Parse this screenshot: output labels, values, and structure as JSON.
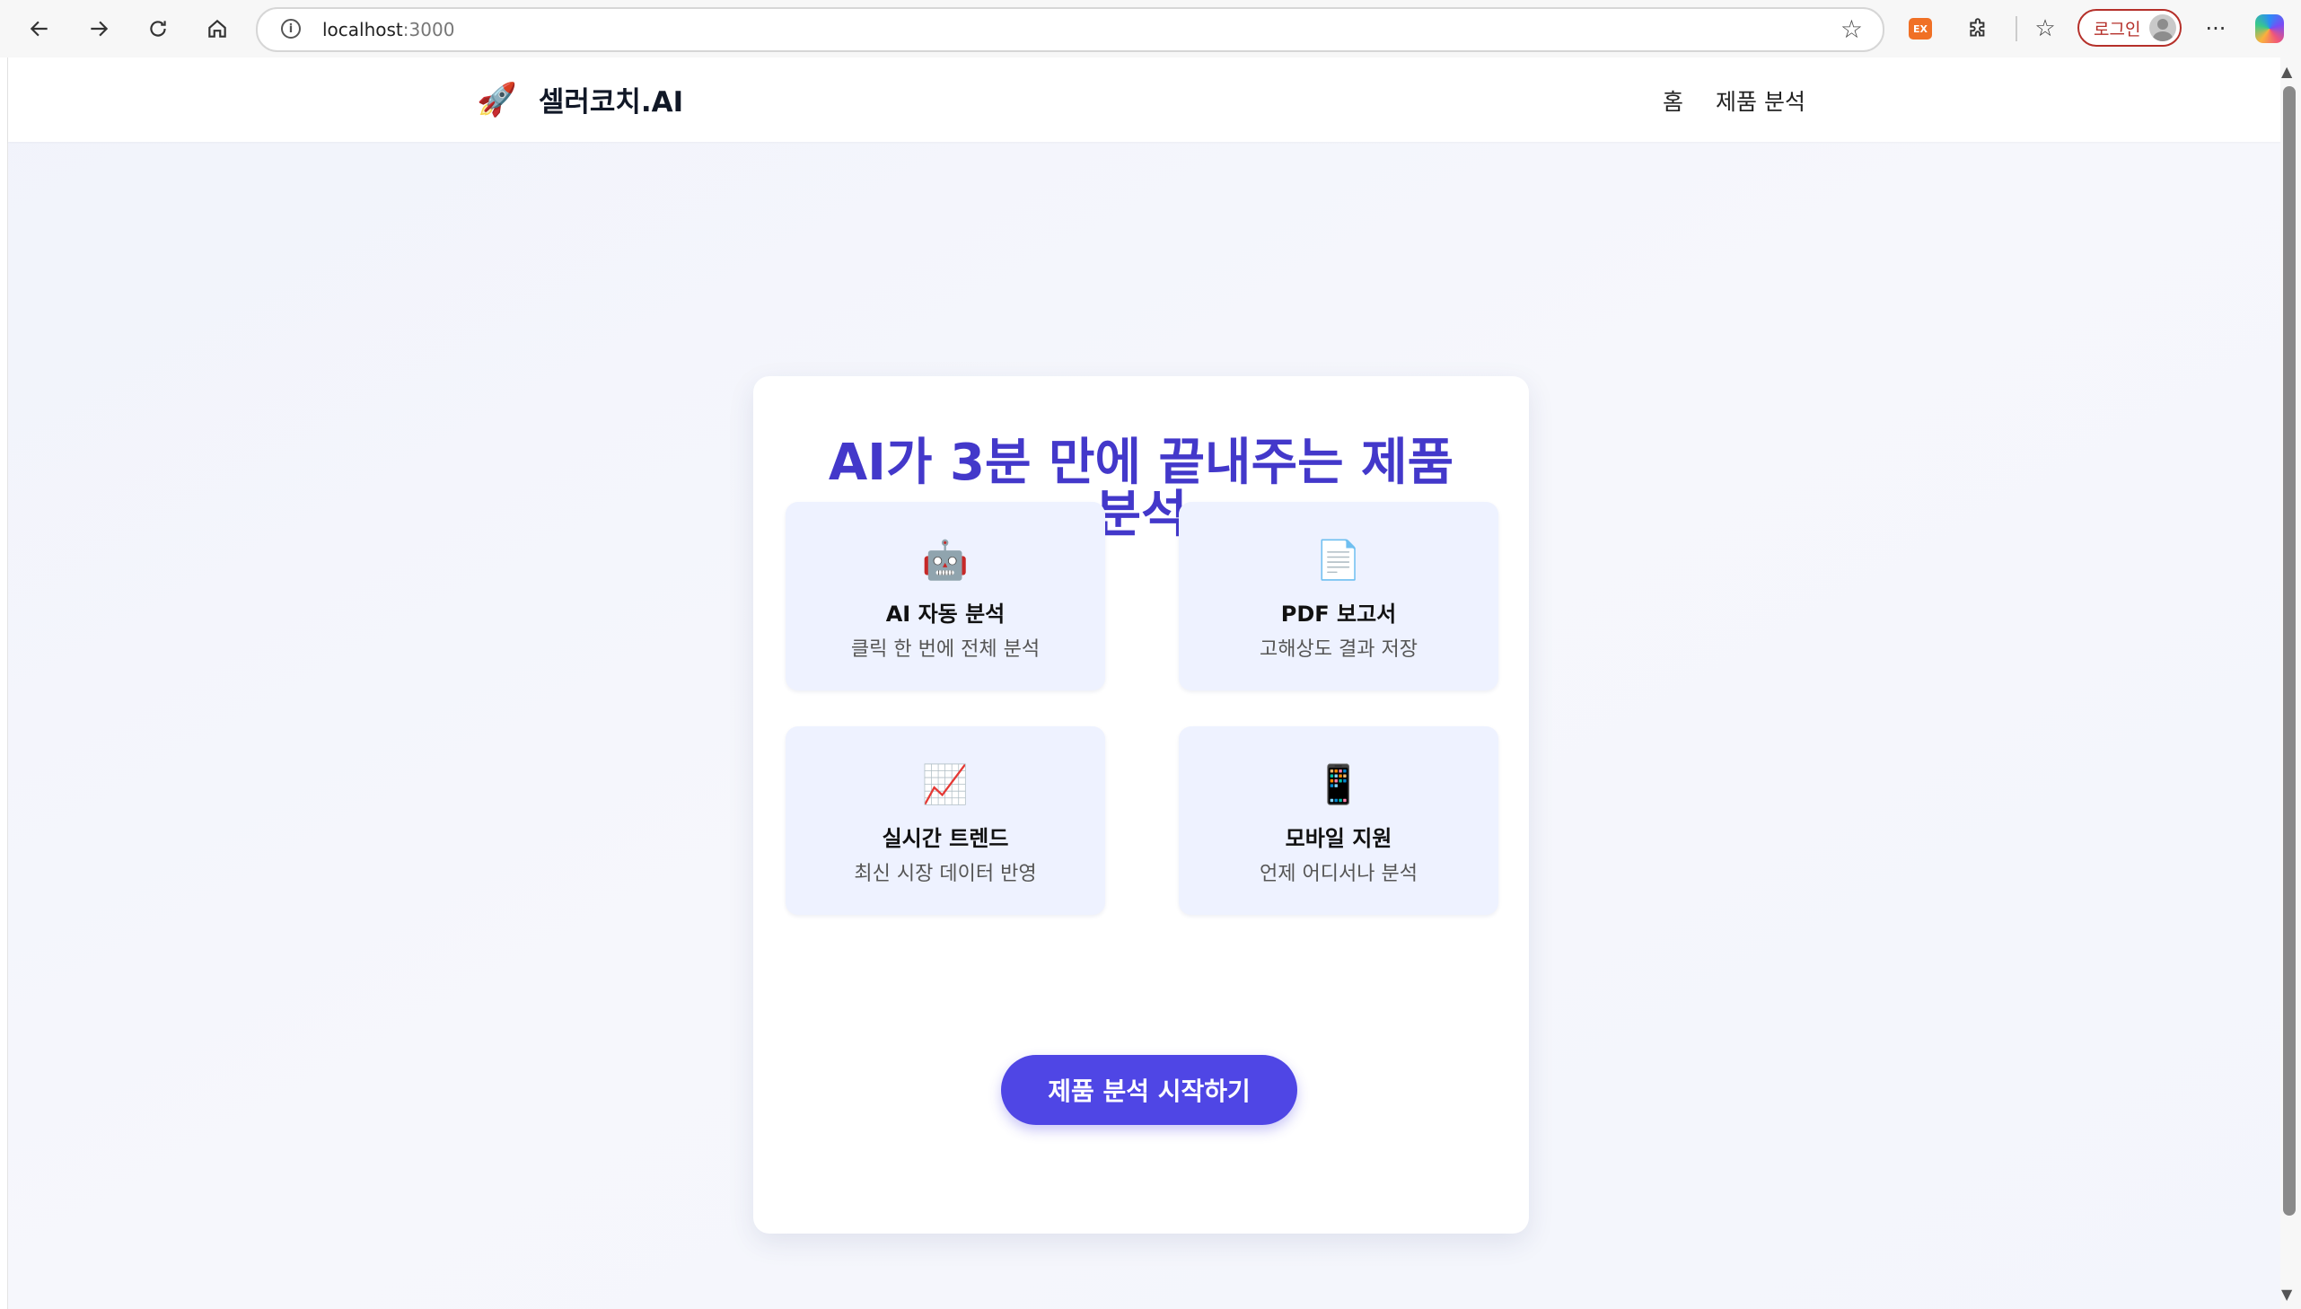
{
  "browser": {
    "url_host": "localhost",
    "url_port": ":3000",
    "login_label": "로그인",
    "ext_badge": "EX"
  },
  "site": {
    "brand_icon": "🚀",
    "brand_name": "셀러코치.AI",
    "nav": [
      "홈",
      "제품 분석"
    ]
  },
  "hero": {
    "title": "AI가 3분 만에 끝내주는 제품 분석"
  },
  "features": [
    {
      "icon": "🤖",
      "icon_name": "robot-icon",
      "title": "AI 자동 분석",
      "desc": "클릭 한 번에 전체 분석"
    },
    {
      "icon": "📄",
      "icon_name": "document-icon",
      "title": "PDF 보고서",
      "desc": "고해상도 결과 저장"
    },
    {
      "icon": "📈",
      "icon_name": "chart-icon",
      "title": "실시간 트렌드",
      "desc": "최신 시장 데이터 반영"
    },
    {
      "icon": "📱",
      "icon_name": "mobile-icon",
      "title": "모바일 지원",
      "desc": "언제 어디서나 분석"
    }
  ],
  "cta": {
    "label": "제품 분석 시작하기"
  },
  "colors": {
    "accent": "#4f46e5",
    "title": "#4338ca",
    "feature_bg": "#eef2ff",
    "login_border": "#b5302a"
  }
}
